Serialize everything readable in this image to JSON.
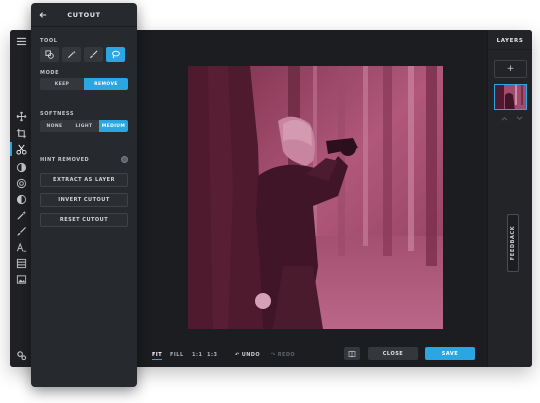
{
  "panel": {
    "title": "CUTOUT",
    "tool_label": "TOOL",
    "tools": [
      {
        "name": "shape-tool-icon",
        "active": false
      },
      {
        "name": "magic-wand-icon",
        "active": false
      },
      {
        "name": "brush-icon",
        "active": false
      },
      {
        "name": "lasso-icon",
        "active": true
      }
    ],
    "mode_label": "MODE",
    "mode_options": [
      "KEEP",
      "REMOVE"
    ],
    "mode_selected": "REMOVE",
    "softness_label": "SOFTNESS",
    "softness_options": [
      "NONE",
      "LIGHT",
      "MEDIUM"
    ],
    "softness_selected": "MEDIUM",
    "hint_label": "HINT REMOVED",
    "buttons": [
      "EXTRACT AS LAYER",
      "INVERT CUTOUT",
      "RESET CUTOUT"
    ]
  },
  "toolbar": {
    "icons": [
      "menu-icon",
      "move-icon",
      "crop-icon",
      "cutout-icon",
      "adjust-icon",
      "filter-icon",
      "contrast-icon",
      "wand-icon",
      "brush-icon",
      "text-icon",
      "layers-icon",
      "image-icon",
      "settings-icon"
    ],
    "active": "cutout-icon"
  },
  "bottom_bar": {
    "zoom_options": [
      "FIT",
      "FILL",
      "1:1",
      "1:3"
    ],
    "zoom_selected": "FIT",
    "undo_label": "UNDO",
    "redo_label": "REDO",
    "close_label": "CLOSE",
    "save_label": "SAVE"
  },
  "layers": {
    "title": "LAYERS",
    "add_label": "+"
  },
  "feedback_label": "FEEDBACK",
  "colors": {
    "accent": "#2aa6e3",
    "photo_tint": "#8a3a55",
    "background": "#1b1d21"
  }
}
